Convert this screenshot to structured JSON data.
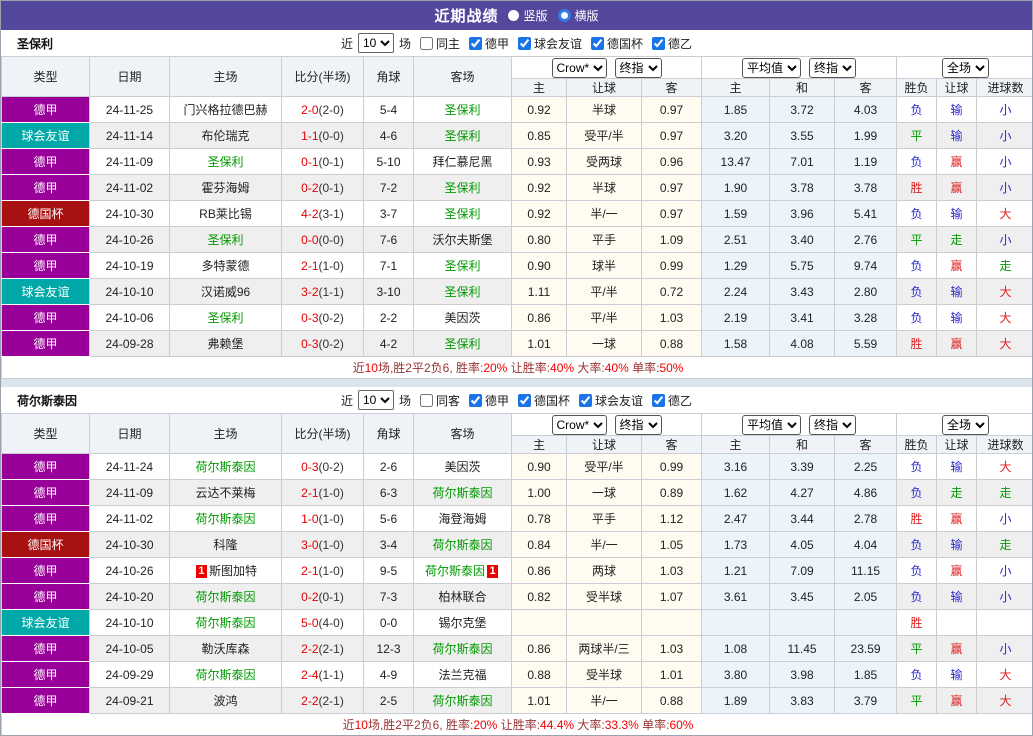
{
  "title_bar": {
    "title": "近期战绩",
    "vertical_label": "竖版",
    "horizontal_label": "横版",
    "selected": "横版"
  },
  "columns": {
    "type": "类型",
    "date": "日期",
    "home": "主场",
    "score": "比分(半场)",
    "corner": "角球",
    "away": "客场",
    "crow_home": "主",
    "crow_handicap": "让球",
    "crow_away": "客",
    "avg_home": "主",
    "avg_draw": "和",
    "avg_away": "客",
    "result_wdl": "胜负",
    "result_handicap": "让球",
    "result_goals": "进球数"
  },
  "selects": {
    "crow": "Crow*",
    "final_index_1": "终指",
    "average": "平均值",
    "final_index_2": "终指",
    "full_match": "全场"
  },
  "filter1": {
    "near": "近",
    "count": "10",
    "games": "场",
    "same_label": "同主",
    "same_checked": false,
    "leagues": [
      {
        "label": "德甲",
        "checked": true
      },
      {
        "label": "球会友谊",
        "checked": true
      },
      {
        "label": "德国杯",
        "checked": true
      },
      {
        "label": "德乙",
        "checked": true
      }
    ]
  },
  "filter2": {
    "near": "近",
    "count": "10",
    "games": "场",
    "same_label": "同客",
    "same_checked": false,
    "leagues": [
      {
        "label": "德甲",
        "checked": true
      },
      {
        "label": "德国杯",
        "checked": true
      },
      {
        "label": "球会友谊",
        "checked": true
      },
      {
        "label": "德乙",
        "checked": true
      }
    ]
  },
  "team1": {
    "name": "圣保利"
  },
  "team2": {
    "name": "荷尔斯泰因"
  },
  "league_colors": {
    "德甲": "#990099",
    "球会友谊": "#00A8A8",
    "德国杯": "#A81111",
    "德乙": "#1E5FA8"
  },
  "result_colors": {
    "胜": "#DD2222",
    "平": "#009900",
    "负": "#2828CC",
    "赢": "#DD2222",
    "输": "#2828CC",
    "走": "#009900",
    "大": "#DD2222",
    "小": "#2828CC"
  },
  "table1": {
    "rows": [
      {
        "league": "德甲",
        "date": "24-11-25",
        "home": "门兴格拉德巴赫",
        "home_subject": false,
        "home_card": "",
        "ft": "2-0",
        "ht": "2-0",
        "corner": "5-4",
        "away": "圣保利",
        "away_subject": true,
        "away_card": "",
        "crow": [
          "0.92",
          "半球",
          "0.97"
        ],
        "avg": [
          "1.85",
          "3.72",
          "4.03"
        ],
        "res": [
          "负",
          "输",
          "小"
        ]
      },
      {
        "league": "球会友谊",
        "date": "24-11-14",
        "home": "布伦瑞克",
        "home_subject": false,
        "home_card": "",
        "ft": "1-1",
        "ht": "0-0",
        "corner": "4-6",
        "away": "圣保利",
        "away_subject": true,
        "away_card": "",
        "crow": [
          "0.85",
          "受平/半",
          "0.97"
        ],
        "avg": [
          "3.20",
          "3.55",
          "1.99"
        ],
        "res": [
          "平",
          "输",
          "小"
        ]
      },
      {
        "league": "德甲",
        "date": "24-11-09",
        "home": "圣保利",
        "home_subject": true,
        "home_card": "",
        "ft": "0-1",
        "ht": "0-1",
        "corner": "5-10",
        "away": "拜仁慕尼黑",
        "away_subject": false,
        "away_card": "",
        "crow": [
          "0.93",
          "受两球",
          "0.96"
        ],
        "avg": [
          "13.47",
          "7.01",
          "1.19"
        ],
        "res": [
          "负",
          "赢",
          "小"
        ]
      },
      {
        "league": "德甲",
        "date": "24-11-02",
        "home": "霍芬海姆",
        "home_subject": false,
        "home_card": "",
        "ft": "0-2",
        "ht": "0-1",
        "corner": "7-2",
        "away": "圣保利",
        "away_subject": true,
        "away_card": "",
        "crow": [
          "0.92",
          "半球",
          "0.97"
        ],
        "avg": [
          "1.90",
          "3.78",
          "3.78"
        ],
        "res": [
          "胜",
          "赢",
          "小"
        ]
      },
      {
        "league": "德国杯",
        "date": "24-10-30",
        "home": "RB莱比锡",
        "home_subject": false,
        "home_card": "",
        "ft": "4-2",
        "ht": "3-1",
        "corner": "3-7",
        "away": "圣保利",
        "away_subject": true,
        "away_card": "",
        "crow": [
          "0.92",
          "半/一",
          "0.97"
        ],
        "avg": [
          "1.59",
          "3.96",
          "5.41"
        ],
        "res": [
          "负",
          "输",
          "大"
        ]
      },
      {
        "league": "德甲",
        "date": "24-10-26",
        "home": "圣保利",
        "home_subject": true,
        "home_card": "",
        "ft": "0-0",
        "ht": "0-0",
        "corner": "7-6",
        "away": "沃尔夫斯堡",
        "away_subject": false,
        "away_card": "",
        "crow": [
          "0.80",
          "平手",
          "1.09"
        ],
        "avg": [
          "2.51",
          "3.40",
          "2.76"
        ],
        "res": [
          "平",
          "走",
          "小"
        ]
      },
      {
        "league": "德甲",
        "date": "24-10-19",
        "home": "多特蒙德",
        "home_subject": false,
        "home_card": "",
        "ft": "2-1",
        "ht": "1-0",
        "corner": "7-1",
        "away": "圣保利",
        "away_subject": true,
        "away_card": "",
        "crow": [
          "0.90",
          "球半",
          "0.99"
        ],
        "avg": [
          "1.29",
          "5.75",
          "9.74"
        ],
        "res": [
          "负",
          "赢",
          "走"
        ]
      },
      {
        "league": "球会友谊",
        "date": "24-10-10",
        "home": "汉诺威96",
        "home_subject": false,
        "home_card": "",
        "ft": "3-2",
        "ht": "1-1",
        "corner": "3-10",
        "away": "圣保利",
        "away_subject": true,
        "away_card": "",
        "crow": [
          "1.11",
          "平/半",
          "0.72"
        ],
        "avg": [
          "2.24",
          "3.43",
          "2.80"
        ],
        "res": [
          "负",
          "输",
          "大"
        ]
      },
      {
        "league": "德甲",
        "date": "24-10-06",
        "home": "圣保利",
        "home_subject": true,
        "home_card": "",
        "ft": "0-3",
        "ht": "0-2",
        "corner": "2-2",
        "away": "美因茨",
        "away_subject": false,
        "away_card": "",
        "crow": [
          "0.86",
          "平/半",
          "1.03"
        ],
        "avg": [
          "2.19",
          "3.41",
          "3.28"
        ],
        "res": [
          "负",
          "输",
          "大"
        ]
      },
      {
        "league": "德甲",
        "date": "24-09-28",
        "home": "弗赖堡",
        "home_subject": false,
        "home_card": "",
        "ft": "0-3",
        "ht": "0-2",
        "corner": "4-2",
        "away": "圣保利",
        "away_subject": true,
        "away_card": "",
        "crow": [
          "1.01",
          "一球",
          "0.88"
        ],
        "avg": [
          "1.58",
          "4.08",
          "5.59"
        ],
        "res": [
          "胜",
          "赢",
          "大"
        ]
      }
    ],
    "summary": [
      [
        "近",
        false
      ],
      [
        "10",
        true
      ],
      [
        "场,胜2平2负6, 胜率:",
        false
      ],
      [
        "20%",
        true
      ],
      [
        " 让胜率:",
        false
      ],
      [
        "40%",
        true
      ],
      [
        " 大率:",
        false
      ],
      [
        "40%",
        true
      ],
      [
        " 单率:",
        false
      ],
      [
        "50%",
        true
      ]
    ]
  },
  "table2": {
    "rows": [
      {
        "league": "德甲",
        "date": "24-11-24",
        "home": "荷尔斯泰因",
        "home_subject": true,
        "home_card": "",
        "ft": "0-3",
        "ht": "0-2",
        "corner": "2-6",
        "away": "美因茨",
        "away_subject": false,
        "away_card": "",
        "crow": [
          "0.90",
          "受平/半",
          "0.99"
        ],
        "avg": [
          "3.16",
          "3.39",
          "2.25"
        ],
        "res": [
          "负",
          "输",
          "大"
        ]
      },
      {
        "league": "德甲",
        "date": "24-11-09",
        "home": "云达不莱梅",
        "home_subject": false,
        "home_card": "",
        "ft": "2-1",
        "ht": "1-0",
        "corner": "6-3",
        "away": "荷尔斯泰因",
        "away_subject": true,
        "away_card": "",
        "crow": [
          "1.00",
          "一球",
          "0.89"
        ],
        "avg": [
          "1.62",
          "4.27",
          "4.86"
        ],
        "res": [
          "负",
          "走",
          "走"
        ]
      },
      {
        "league": "德甲",
        "date": "24-11-02",
        "home": "荷尔斯泰因",
        "home_subject": true,
        "home_card": "",
        "ft": "1-0",
        "ht": "1-0",
        "corner": "5-6",
        "away": "海登海姆",
        "away_subject": false,
        "away_card": "",
        "crow": [
          "0.78",
          "平手",
          "1.12"
        ],
        "avg": [
          "2.47",
          "3.44",
          "2.78"
        ],
        "res": [
          "胜",
          "赢",
          "小"
        ]
      },
      {
        "league": "德国杯",
        "date": "24-10-30",
        "home": "科隆",
        "home_subject": false,
        "home_card": "",
        "ft": "3-0",
        "ht": "1-0",
        "corner": "3-4",
        "away": "荷尔斯泰因",
        "away_subject": true,
        "away_card": "",
        "crow": [
          "0.84",
          "半/一",
          "1.05"
        ],
        "avg": [
          "1.73",
          "4.05",
          "4.04"
        ],
        "res": [
          "负",
          "输",
          "走"
        ]
      },
      {
        "league": "德甲",
        "date": "24-10-26",
        "home": "斯图加特",
        "home_subject": false,
        "home_card": "1",
        "ft": "2-1",
        "ht": "1-0",
        "corner": "9-5",
        "away": "荷尔斯泰因",
        "away_subject": true,
        "away_card": "1",
        "crow": [
          "0.86",
          "两球",
          "1.03"
        ],
        "avg": [
          "1.21",
          "7.09",
          "11.15"
        ],
        "res": [
          "负",
          "赢",
          "小"
        ]
      },
      {
        "league": "德甲",
        "date": "24-10-20",
        "home": "荷尔斯泰因",
        "home_subject": true,
        "home_card": "",
        "ft": "0-2",
        "ht": "0-1",
        "corner": "7-3",
        "away": "柏林联合",
        "away_subject": false,
        "away_card": "",
        "crow": [
          "0.82",
          "受半球",
          "1.07"
        ],
        "avg": [
          "3.61",
          "3.45",
          "2.05"
        ],
        "res": [
          "负",
          "输",
          "小"
        ]
      },
      {
        "league": "球会友谊",
        "date": "24-10-10",
        "home": "荷尔斯泰因",
        "home_subject": true,
        "home_card": "",
        "ft": "5-0",
        "ht": "4-0",
        "corner": "0-0",
        "away": "锡尔克堡",
        "away_subject": false,
        "away_card": "",
        "crow": [
          "",
          "",
          ""
        ],
        "avg": [
          "",
          "",
          ""
        ],
        "res": [
          "胜",
          "",
          ""
        ]
      },
      {
        "league": "德甲",
        "date": "24-10-05",
        "home": "勒沃库森",
        "home_subject": false,
        "home_card": "",
        "ft": "2-2",
        "ht": "2-1",
        "corner": "12-3",
        "away": "荷尔斯泰因",
        "away_subject": true,
        "away_card": "",
        "crow": [
          "0.86",
          "两球半/三",
          "1.03"
        ],
        "avg": [
          "1.08",
          "11.45",
          "23.59"
        ],
        "res": [
          "平",
          "赢",
          "小"
        ]
      },
      {
        "league": "德甲",
        "date": "24-09-29",
        "home": "荷尔斯泰因",
        "home_subject": true,
        "home_card": "",
        "ft": "2-4",
        "ht": "1-1",
        "corner": "4-9",
        "away": "法兰克福",
        "away_subject": false,
        "away_card": "",
        "crow": [
          "0.88",
          "受半球",
          "1.01"
        ],
        "avg": [
          "3.80",
          "3.98",
          "1.85"
        ],
        "res": [
          "负",
          "输",
          "大"
        ]
      },
      {
        "league": "德甲",
        "date": "24-09-21",
        "home": "波鸿",
        "home_subject": false,
        "home_card": "",
        "ft": "2-2",
        "ht": "2-1",
        "corner": "2-5",
        "away": "荷尔斯泰因",
        "away_subject": true,
        "away_card": "",
        "crow": [
          "1.01",
          "半/一",
          "0.88"
        ],
        "avg": [
          "1.89",
          "3.83",
          "3.79"
        ],
        "res": [
          "平",
          "赢",
          "大"
        ]
      }
    ],
    "summary": [
      [
        "近",
        false
      ],
      [
        "10",
        true
      ],
      [
        "场,胜2平2负6, 胜率:",
        false
      ],
      [
        "20%",
        true
      ],
      [
        " 让胜率:",
        false
      ],
      [
        "44.4%",
        true
      ],
      [
        " 大率:",
        false
      ],
      [
        "33.3%",
        true
      ],
      [
        " 单率:",
        false
      ],
      [
        "60%",
        true
      ]
    ]
  }
}
